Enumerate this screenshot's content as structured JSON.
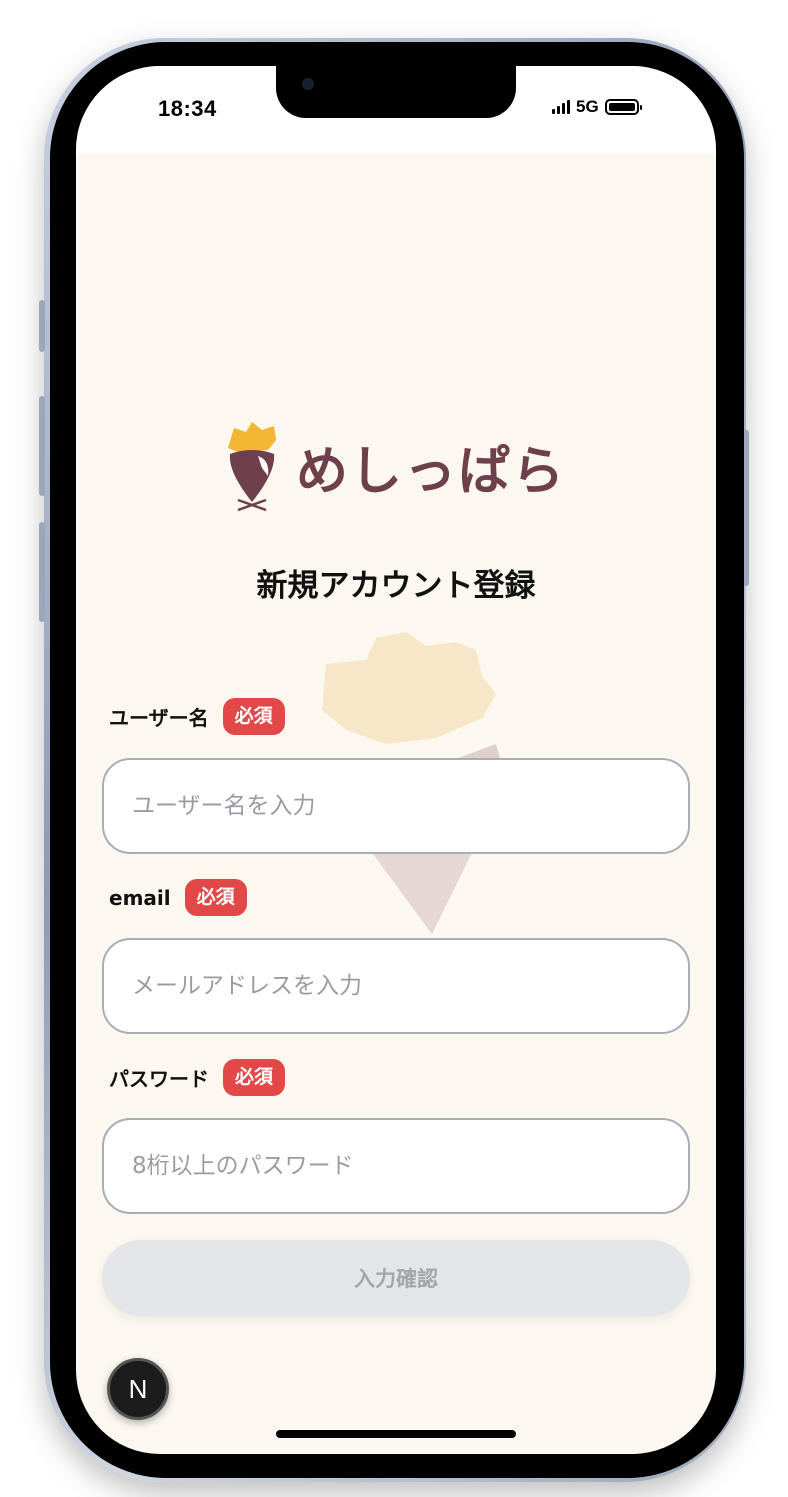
{
  "status_bar": {
    "time": "18:34",
    "network": "5G"
  },
  "app": {
    "logo_text": "めしっぱら",
    "title": "新規アカウント登録"
  },
  "form": {
    "username": {
      "label": "ユーザー名",
      "required_badge": "必須",
      "placeholder": "ユーザー名を入力",
      "value": ""
    },
    "email": {
      "label": "email",
      "required_badge": "必須",
      "placeholder": "メールアドレスを入力",
      "value": ""
    },
    "password": {
      "label": "パスワード",
      "required_badge": "必須",
      "placeholder": "8桁以上のパスワード",
      "value": ""
    },
    "submit_label": "入力確認"
  },
  "dev_badge": {
    "label": "N"
  },
  "colors": {
    "background": "#fcf8f0",
    "required": "#e34848",
    "logo": "#6e3f4c",
    "logo_accent": "#f2b632",
    "button_disabled": "#e4e5e9"
  }
}
